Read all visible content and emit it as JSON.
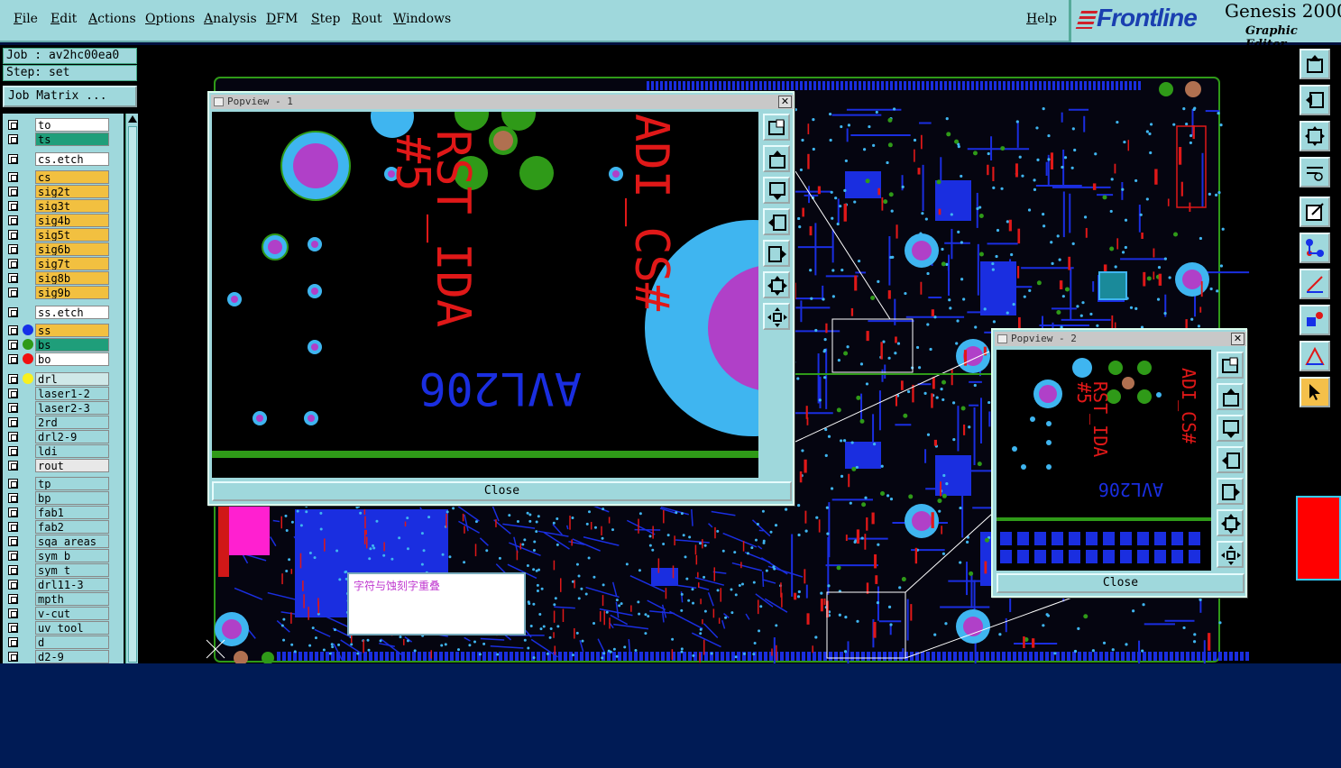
{
  "menu": {
    "items": [
      "File",
      "Edit",
      "Actions",
      "Options",
      "Analysis",
      "DFM",
      "Step",
      "Rout",
      "Windows"
    ],
    "help": "Help"
  },
  "brand": {
    "logo": "Frontline",
    "product": "Genesis 2000",
    "subtitle": "Graphic Editor"
  },
  "job": {
    "job_label": "Job : av2hc00ea0",
    "step_label": "Step: set",
    "matrix_button": "Job Matrix ..."
  },
  "layers": [
    {
      "name": "to",
      "bg": "#ffffff",
      "dot": ""
    },
    {
      "name": "ts",
      "bg": "#1f9e7a",
      "dot": ""
    },
    {
      "name": "cs.etch",
      "bg": "#ffffff",
      "dot": ""
    },
    {
      "name": "cs",
      "bg": "#f2c040",
      "dot": ""
    },
    {
      "name": "sig2t",
      "bg": "#f2c040",
      "dot": ""
    },
    {
      "name": "sig3t",
      "bg": "#f2c040",
      "dot": ""
    },
    {
      "name": "sig4b",
      "bg": "#f2c040",
      "dot": ""
    },
    {
      "name": "sig5t",
      "bg": "#f2c040",
      "dot": ""
    },
    {
      "name": "sig6b",
      "bg": "#f2c040",
      "dot": ""
    },
    {
      "name": "sig7t",
      "bg": "#f2c040",
      "dot": ""
    },
    {
      "name": "sig8b",
      "bg": "#f2c040",
      "dot": ""
    },
    {
      "name": "sig9b",
      "bg": "#f2c040",
      "dot": ""
    },
    {
      "name": "ss.etch",
      "bg": "#ffffff",
      "dot": ""
    },
    {
      "name": "ss",
      "bg": "#f2c040",
      "dot": "#1530e8"
    },
    {
      "name": "bs",
      "bg": "#1f9e7a",
      "dot": "#2f9a18"
    },
    {
      "name": "bo",
      "bg": "#ffffff",
      "dot": "#f01010"
    },
    {
      "name": "drl",
      "bg": "#cfe8e8",
      "dot": "#f8f020"
    },
    {
      "name": "laser1-2",
      "bg": "#9fd8dc",
      "dot": ""
    },
    {
      "name": "laser2-3",
      "bg": "#9fd8dc",
      "dot": ""
    },
    {
      "name": "2rd",
      "bg": "#9fd8dc",
      "dot": ""
    },
    {
      "name": "drl2-9",
      "bg": "#9fd8dc",
      "dot": ""
    },
    {
      "name": "ldi",
      "bg": "#9fd8dc",
      "dot": ""
    },
    {
      "name": "rout",
      "bg": "#e8e8e8",
      "dot": ""
    },
    {
      "name": "tp",
      "bg": "#9fd8dc",
      "dot": ""
    },
    {
      "name": "bp",
      "bg": "#9fd8dc",
      "dot": ""
    },
    {
      "name": "fab1",
      "bg": "#9fd8dc",
      "dot": ""
    },
    {
      "name": "fab2",
      "bg": "#9fd8dc",
      "dot": ""
    },
    {
      "name": "sqa_areas",
      "bg": "#9fd8dc",
      "dot": ""
    },
    {
      "name": "sym_b",
      "bg": "#9fd8dc",
      "dot": ""
    },
    {
      "name": "sym_t",
      "bg": "#9fd8dc",
      "dot": ""
    },
    {
      "name": "drl11-3",
      "bg": "#9fd8dc",
      "dot": ""
    },
    {
      "name": "mpth",
      "bg": "#9fd8dc",
      "dot": ""
    },
    {
      "name": "v-cut",
      "bg": "#9fd8dc",
      "dot": ""
    },
    {
      "name": "uv_tool",
      "bg": "#9fd8dc",
      "dot": ""
    },
    {
      "name": "d",
      "bg": "#9fd8dc",
      "dot": ""
    },
    {
      "name": "d2-9",
      "bg": "#9fd8dc",
      "dot": ""
    }
  ],
  "popview1": {
    "title": "Popview - 1",
    "close": "Close",
    "text_red_1": "RST_IDA",
    "text_red_2": "#5",
    "text_red_3": "ADI_CS#",
    "text_blue": "AVL206"
  },
  "popview2": {
    "title": "Popview - 2",
    "close": "Close",
    "text_red_1": "RST_IDA",
    "text_red_2": "#5",
    "text_red_3": "ADI_CS#",
    "text_blue": "AVL206"
  },
  "note": {
    "text": "字符与蚀刻字重叠"
  },
  "colors": {
    "panel": "#9fd8dc",
    "signal": "#f2c040",
    "solder_green": "#1f9e7a",
    "pad_cyan": "#3fb5f0",
    "pad_magenta": "#b040c8",
    "silk_red": "#e01818",
    "copper_blue": "#1a2ee0"
  }
}
